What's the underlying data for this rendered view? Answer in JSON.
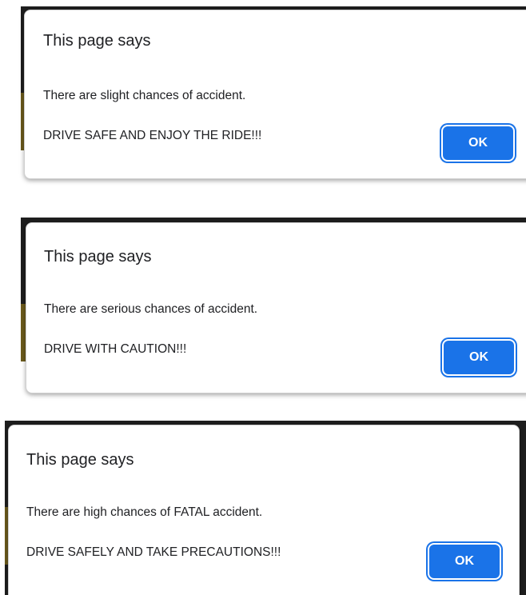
{
  "dialogs": [
    {
      "title": "This page says",
      "message_line1": "There are slight chances of accident.",
      "message_line2": "DRIVE SAFE AND ENJOY THE RIDE!!!",
      "ok_label": "OK"
    },
    {
      "title": "This page says",
      "message_line1": "There are serious chances of accident.",
      "message_line2": "DRIVE WITH CAUTION!!!",
      "ok_label": "OK"
    },
    {
      "title": "This page says",
      "message_line1": "There are high chances of FATAL accident.",
      "message_line2": "DRIVE SAFELY AND TAKE PRECAUTIONS!!!",
      "ok_label": "OK"
    }
  ],
  "colors": {
    "accent": "#1a73e8",
    "background_window": "#1e1e1e"
  }
}
